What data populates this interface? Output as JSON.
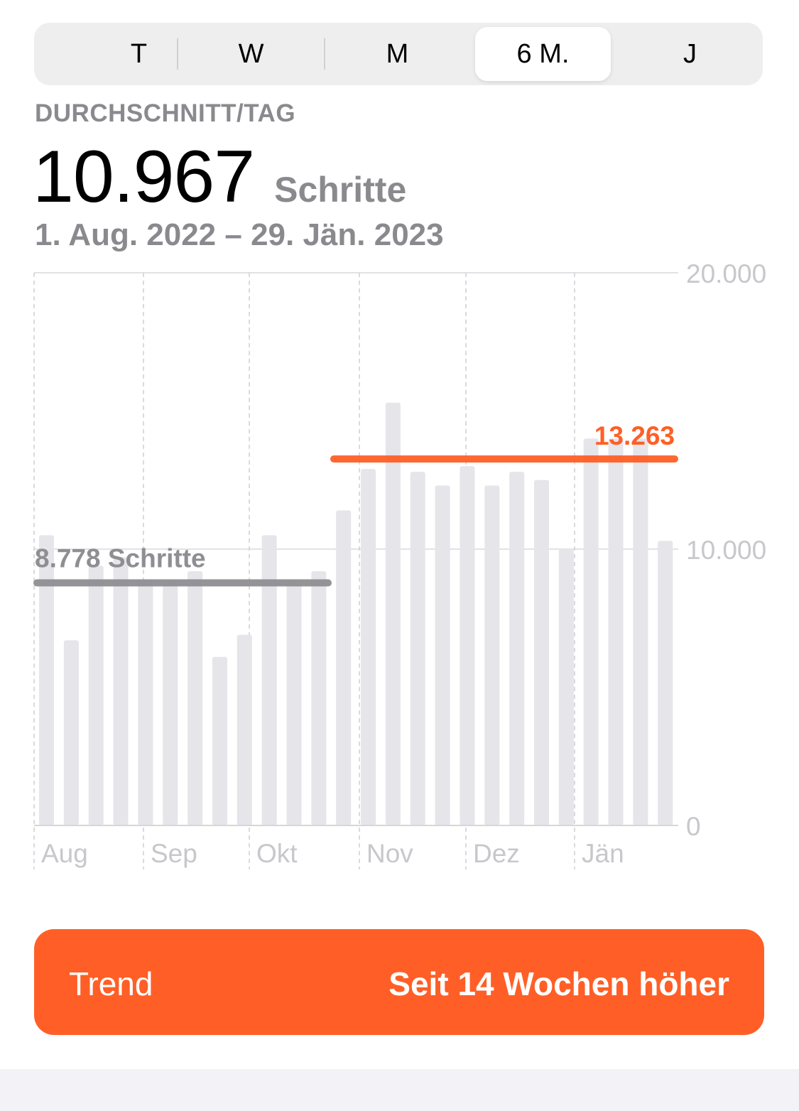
{
  "segmented": {
    "options": [
      "T",
      "W",
      "M",
      "6 M.",
      "J"
    ],
    "selected": "6 M."
  },
  "summary": {
    "label": "DURCHSCHNITT/TAG",
    "value": "10.967",
    "unit": "Schritte",
    "range": "1. Aug. 2022 – 29. Jän. 2023"
  },
  "chart_data": {
    "type": "bar",
    "ylim": [
      0,
      20000
    ],
    "y_ticks": [
      0,
      10000,
      20000
    ],
    "y_tick_labels": [
      "0",
      "10.000",
      "20.000"
    ],
    "x_month_labels": [
      "Aug",
      "Sep",
      "Okt",
      "Nov",
      "Dez",
      "Jän"
    ],
    "values": [
      10500,
      6700,
      9400,
      9700,
      8900,
      8900,
      9200,
      6100,
      6900,
      10500,
      8900,
      9200,
      11400,
      12900,
      15300,
      12800,
      12300,
      13000,
      12300,
      12800,
      12500,
      10000,
      14000,
      14000,
      14000,
      10300
    ],
    "bar_color": "#e5e5ea",
    "reference_lines": [
      {
        "label": "8.778 Schritte",
        "value": 8778,
        "color": "#8e8e93"
      },
      {
        "label": "13.263",
        "value": 13263,
        "color": "#ff5f26"
      }
    ],
    "grid": true
  },
  "trend": {
    "label": "Trend",
    "value": "Seit 14 Wochen höher",
    "color": "#ff5f26"
  }
}
